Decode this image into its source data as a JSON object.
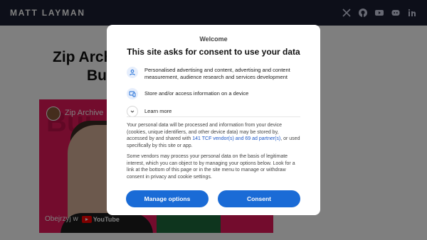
{
  "header": {
    "brand": "MATT LAYMAN",
    "social": [
      "x-icon",
      "github-icon",
      "youtube-icon",
      "discord-icon",
      "linkedin-icon"
    ]
  },
  "post": {
    "title_line1": "Zip Archi",
    "title_line2": "Bu"
  },
  "video": {
    "title": "Zip Archive",
    "watch_on": "Obejrzyj w",
    "platform": "YouTube"
  },
  "dialog": {
    "welcome": "Welcome",
    "headline": "This site asks for consent to use your data",
    "purposes": [
      {
        "icon": "person-icon",
        "text": "Personalised advertising and content, advertising and content measurement, audience research and services development"
      },
      {
        "icon": "device-icon",
        "text": "Store and/or access information on a device"
      }
    ],
    "learn_more": "Learn more",
    "paragraph1_before": "Your personal data will be processed and information from your device (cookies, unique identifiers, and other device data) may be stored by, accessed by and shared with ",
    "paragraph1_link": "141 TCF vendor(s) and 69 ad partner(s)",
    "paragraph1_after": ", or used specifically by this site or app.",
    "paragraph2": "Some vendors may process your personal data on the basis of legitimate interest, which you can object to by managing your options below. Look for a link at the bottom of this page or in the site menu to manage or withdraw consent in privacy and cookie settings.",
    "manage_label": "Manage options",
    "consent_label": "Consent"
  },
  "colors": {
    "nav_bg": "#1b1f33",
    "button": "#1a6bd6",
    "link": "#1a55c6",
    "video_bg": "#e7195a"
  }
}
